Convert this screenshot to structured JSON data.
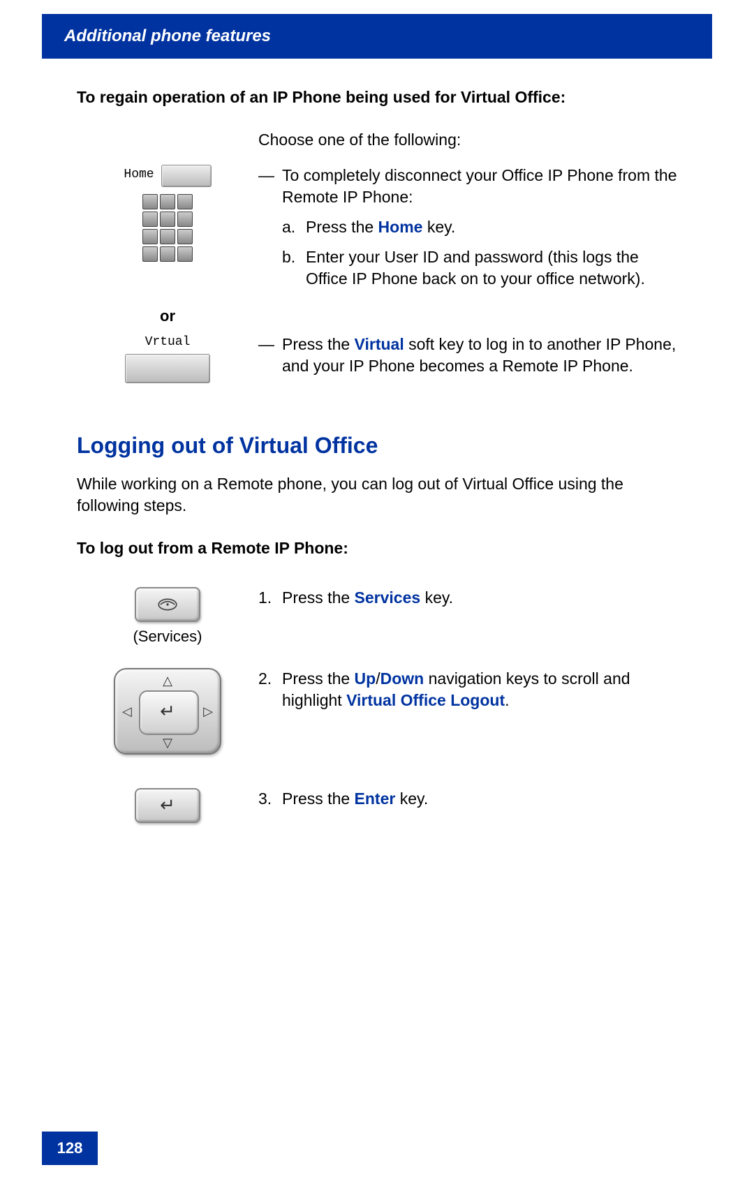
{
  "header": {
    "title": "Additional phone features"
  },
  "section1": {
    "heading": "To regain operation of an IP Phone being used for Virtual Office:",
    "intro": "Choose one of the following:",
    "home_label": "Home",
    "or_label": "or",
    "virtual_label": "Vrtual",
    "bullet1_pre": "To completely disconnect your Office IP Phone from the Remote IP Phone:",
    "step_a_pre": "Press the ",
    "step_a_key": "Home",
    "step_a_post": " key.",
    "step_b": "Enter your User ID and password (this logs the Office IP Phone back on to your office network).",
    "bullet2_pre": "Press the ",
    "bullet2_key": "Virtual",
    "bullet2_post": " soft key to log in to another IP Phone, and your IP Phone becomes a Remote IP Phone."
  },
  "section2": {
    "heading": "Logging out of Virtual Office",
    "intro": "While working on a Remote phone, you can log out of Virtual Office using the following steps.",
    "sub_heading": "To log out from a Remote IP Phone:",
    "services_label": "(Services)",
    "step1_pre": "Press the ",
    "step1_key": "Services",
    "step1_post": " key.",
    "step2_pre": "Press the ",
    "step2_key1": "Up",
    "step2_slash": "/",
    "step2_key2": "Down",
    "step2_mid": " navigation keys to scroll and highlight ",
    "step2_key3": "Virtual Office Logout",
    "step2_post": ".",
    "step3_pre": "Press the ",
    "step3_key": "Enter",
    "step3_post": " key."
  },
  "footer": {
    "page": "128"
  }
}
